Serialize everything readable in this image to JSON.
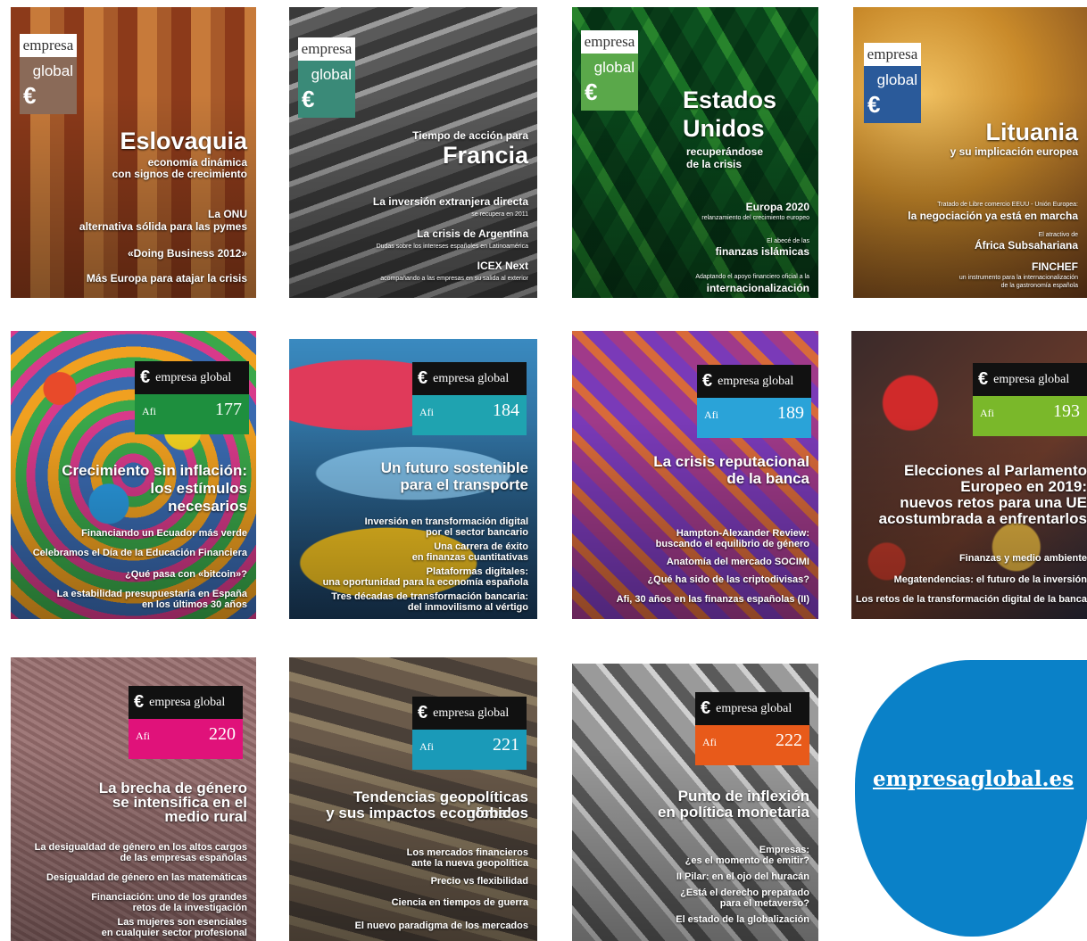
{
  "site": {
    "link_text": "empresaglobal.es",
    "blob_color": "#0a81c8"
  },
  "logo_old": {
    "word": "empresa",
    "sub": "global",
    "mark": "€"
  },
  "logo_new": {
    "mark": "€",
    "brand": "empresa global",
    "afi": "Afi"
  },
  "covers": [
    {
      "theme": "#b8612a",
      "logo_color": "#8a6a58",
      "title": "Eslovaquia",
      "sub1": "economía dinámica",
      "sub2": "con signos de crecimiento",
      "l1a": "La ONU",
      "l1b": "alternativa sólida para las pymes",
      "l2": "«Doing Business 2012»",
      "l3": "Más Europa para atajar la crisis"
    },
    {
      "theme": "#565656",
      "logo_color": "#3a8a78",
      "pre": "Tiempo de acción para",
      "title": "Francia",
      "l1": "La inversión extranjera directa",
      "l1s": "se recupera en 2011",
      "l2": "La crisis de Argentina",
      "l2s": "Dudas sobre los intereses españoles en Latinoamérica",
      "l3": "ICEX Next",
      "l3s": "acompañando a las empresas en su salida al exterior"
    },
    {
      "theme": "#2e8f5a",
      "logo_color": "#5aa84a",
      "title1": "Estados",
      "title2": "Unidos",
      "sub1": "recuperándose",
      "sub2": "de la crisis",
      "l1": "Europa 2020",
      "l1s": "relanzamiento del crecimiento europeo",
      "l2s": "El abecé de las",
      "l2": "finanzas islámicas",
      "l3s": "Adaptando el apoyo financiero oficial a la",
      "l3": "internacionalización"
    },
    {
      "theme": "#c98a2a",
      "logo_color": "#2a5a9a",
      "title": "Lituania",
      "sub": "y su implicación europea",
      "l1s": "Tratado de Libre comercio EEUU - Unión Europea:",
      "l1": "la negociación ya está en marcha",
      "l2s": "El atractivo de",
      "l2": "África Subsahariana",
      "l3": "FINCHEF",
      "l3s1": "un instrumento para la internacionalización",
      "l3s2": "de la gastronomía española"
    },
    {
      "theme": "#3a6ab0",
      "num_color": "#1e8f3e",
      "num": "177",
      "t1": "Crecimiento sin inflación:",
      "t2": "los estímulos",
      "t3": "necesarios",
      "i1": "Financiando un Ecuador más verde",
      "i2": "Celebramos el Día de la Educación Financiera",
      "i3": "¿Qué pasa con «bitcoin»?",
      "i4a": "La estabilidad presupuestaria en España",
      "i4b": "en los últimos 30 años"
    },
    {
      "theme": "#3a8ac0",
      "num_color": "#1fa3b0",
      "num": "184",
      "t1": "Un futuro sostenible",
      "t2": "para el transporte",
      "i1a": "Inversión en transformación digital",
      "i1b": "por el sector bancario",
      "i2a": "Una carrera de éxito",
      "i2b": "en finanzas cuantitativas",
      "i3a": "Plataformas digitales:",
      "i3b": "una oportunidad para la economía española",
      "i4a": "Tres décadas de transformación bancaria:",
      "i4b": "del inmovilismo al vértigo"
    },
    {
      "theme": "#a03a8a",
      "num_color": "#2aa3d8",
      "num": "189",
      "t1": "La crisis reputacional",
      "t2": "de la banca",
      "i1a": "Hampton-Alexander Review:",
      "i1b": "buscando el equilibrio de género",
      "i2": "Anatomía del mercado SOCIMI",
      "i3": "¿Qué ha sido de las criptodivisas?",
      "i4": "Afi, 30 años en las finanzas españolas (II)"
    },
    {
      "theme": "#b04a2a",
      "num_color": "#7ab82a",
      "num": "193",
      "t1": "Elecciones al Parlamento",
      "t2": "Europeo en 2019:",
      "t3": "nuevos retos para una UE",
      "t4": "acostumbrada a enfrentarlos",
      "i1": "Finanzas y medio ambiente",
      "i2": "Megatendencias: el futuro de la inversión",
      "i3": "Los retos de la transformación digital de la banca"
    },
    {
      "theme": "#a07a7a",
      "num_color": "#e0127a",
      "num": "220",
      "t1": "La brecha de género",
      "t2": "se intensifica en el",
      "t3": "medio rural",
      "i1a": "La desigualdad de género en los altos cargos",
      "i1b": "de las empresas españolas",
      "i2": "Desigualdad de género en las matemáticas",
      "i3a": "Financiación: uno de los grandes",
      "i3b": "retos de la investigación",
      "i4a": "Las mujeres son esenciales",
      "i4b": "en cualquier sector profesional"
    },
    {
      "theme": "#6a5a4a",
      "num_color": "#1a9ab8",
      "num": "221",
      "t1": "Tendencias geopolíticas globales",
      "t2": "y sus impactos económicos",
      "i1a": "Los mercados financieros",
      "i1b": "ante la nueva geopolítica",
      "i2": "Precio vs flexibilidad",
      "i3": "Ciencia en tiempos de guerra",
      "i4": "El nuevo paradigma de los mercados"
    },
    {
      "theme": "#8a8a8a",
      "num_color": "#e85a1a",
      "num": "222",
      "t1": "Punto de inflexión",
      "t2": "en política monetaria",
      "i1a": "Empresas:",
      "i1b": "¿es el momento de emitir?",
      "i2": "II Pilar: en el ojo del huracán",
      "i3a": "¿Está el derecho preparado",
      "i3b": "para el metaverso?",
      "i4": "El estado de la globalización"
    }
  ]
}
